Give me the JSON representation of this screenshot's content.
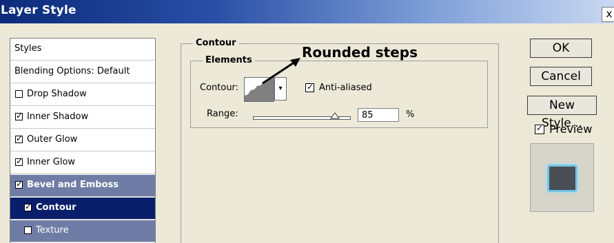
{
  "window": {
    "title": "Layer Style",
    "close_label": "x"
  },
  "styles_list": {
    "header": "Styles",
    "blending": "Blending Options: Default",
    "items": [
      {
        "label": "Drop Shadow",
        "checked": false
      },
      {
        "label": "Inner Shadow",
        "checked": true
      },
      {
        "label": "Outer Glow",
        "checked": true
      },
      {
        "label": "Inner Glow",
        "checked": true
      },
      {
        "label": "Bevel and Emboss",
        "checked": true,
        "state": "highlighted"
      },
      {
        "label": "Contour",
        "checked": true,
        "state": "selected"
      },
      {
        "label": "Texture",
        "checked": false,
        "state": "highlighted"
      }
    ]
  },
  "contour_panel": {
    "group_title": "Contour",
    "elements_title": "Elements",
    "contour_label": "Contour:",
    "anti_aliased_label": "Anti-aliased",
    "anti_aliased_checked": true,
    "range_label": "Range:",
    "range_value": "85",
    "range_unit": "%",
    "range_slider_fraction": 0.85
  },
  "annotation": {
    "text": "Rounded steps"
  },
  "buttons": {
    "ok": "OK",
    "cancel": "Cancel",
    "new_style": "New Style..."
  },
  "preview": {
    "label": "Preview",
    "checked": true
  },
  "colors": {
    "title_bar_start": "#0b2b7a",
    "selected_row": "#0a1f6b",
    "highlight_row": "#6f7da6",
    "preview_glow": "#73c5e8"
  }
}
